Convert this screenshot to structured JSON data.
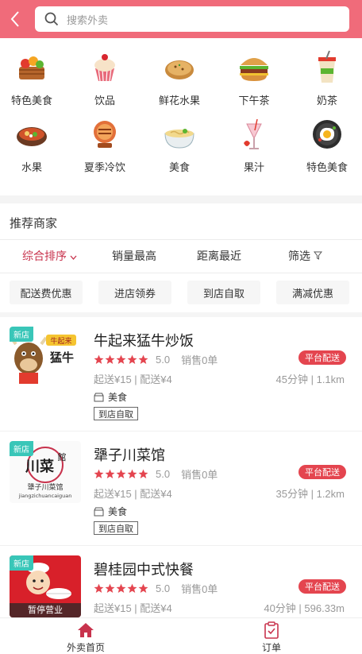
{
  "colors": {
    "header": "#f06b7a",
    "accent": "#c8334d",
    "badge": "#e4454f",
    "new_tag": "#39c6b8",
    "star": "#e4454f"
  },
  "search": {
    "placeholder": "搜索外卖"
  },
  "categories": [
    {
      "label": "特色美食",
      "icon": "basket-food-icon"
    },
    {
      "label": "饮品",
      "icon": "cupcake-icon"
    },
    {
      "label": "鲜花水果",
      "icon": "pancake-icon"
    },
    {
      "label": "下午茶",
      "icon": "burger-icon"
    },
    {
      "label": "奶茶",
      "icon": "bubble-tea-icon"
    },
    {
      "label": "水果",
      "icon": "hotpot-icon"
    },
    {
      "label": "夏季冷饮",
      "icon": "bbq-icon"
    },
    {
      "label": "美食",
      "icon": "noodle-bowl-icon"
    },
    {
      "label": "果汁",
      "icon": "juice-glass-icon"
    },
    {
      "label": "特色美食",
      "icon": "fried-egg-pan-icon"
    }
  ],
  "section": {
    "title": "推荐商家"
  },
  "sort_options": [
    "综合排序",
    "销量最高",
    "距离最近",
    "筛选"
  ],
  "filter_chips": [
    "配送费优惠",
    "进店领券",
    "到店自取",
    "满减优惠"
  ],
  "merchants": [
    {
      "name": "牛起来猛牛炒饭",
      "new_tag": "新店",
      "score": "5.0",
      "sales": "销售0单",
      "delivery_badge": "平台配送",
      "fees": "起送¥15 | 配送¥4",
      "distance": "45分钟 | 1.1km",
      "category": "美食",
      "pickup": "到店自取"
    },
    {
      "name": "犟子川菜馆",
      "new_tag": "新店",
      "score": "5.0",
      "sales": "销售0单",
      "delivery_badge": "平台配送",
      "fees": "起送¥15 | 配送¥4",
      "distance": "35分钟 | 1.2km",
      "category": "美食",
      "pickup": "到店自取"
    },
    {
      "name": "碧桂园中式快餐",
      "new_tag": "新店",
      "score": "5.0",
      "sales": "销售0单",
      "delivery_badge": "平台配送",
      "fees": "起送¥15 | 配送¥4",
      "distance": "40分钟 | 596.33m",
      "paused": "暂停营业"
    }
  ],
  "thumb_text": {
    "m1_sign": "猛牛",
    "m2_title": "川菜",
    "m2_title_side": "館",
    "m2_sub": "犟子川菜馆",
    "m2_pinyin": "jiangzichuancaiguan"
  },
  "bottom_nav": [
    {
      "label": "外卖首页",
      "icon": "home-icon"
    },
    {
      "label": "订单",
      "icon": "order-clipboard-icon"
    }
  ]
}
